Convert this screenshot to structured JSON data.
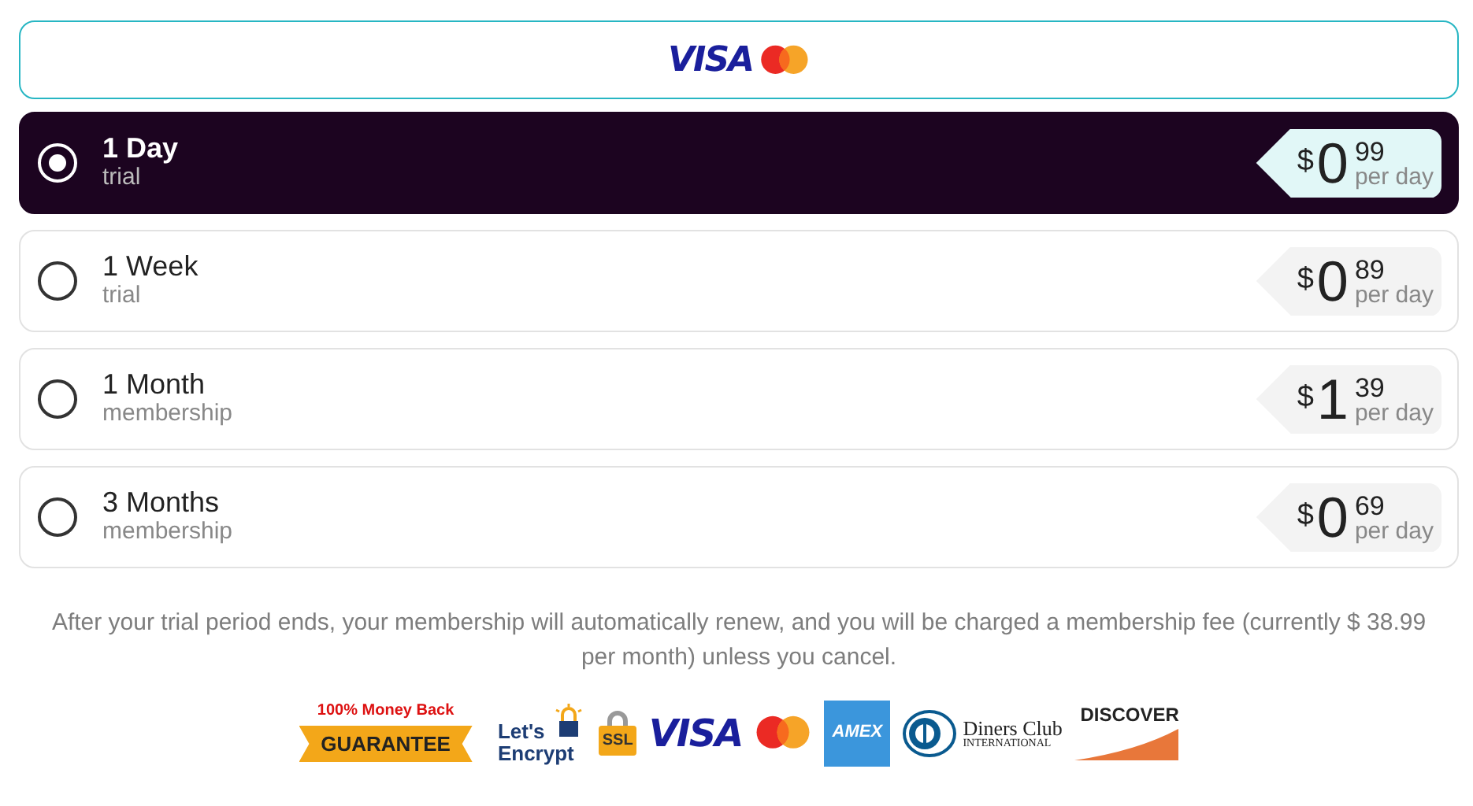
{
  "header_card": {
    "logos": [
      {
        "kind": "visa",
        "text": "VISA"
      },
      {
        "kind": "mastercard"
      }
    ]
  },
  "plans": [
    {
      "title": "1 Day",
      "subtitle": "trial",
      "selected": true,
      "currency": "$",
      "whole": "0",
      "cents": "99",
      "unit": "per day"
    },
    {
      "title": "1 Week",
      "subtitle": "trial",
      "selected": false,
      "currency": "$",
      "whole": "0",
      "cents": "89",
      "unit": "per day"
    },
    {
      "title": "1 Month",
      "subtitle": "membership",
      "selected": false,
      "currency": "$",
      "whole": "1",
      "cents": "39",
      "unit": "per day"
    },
    {
      "title": "3 Months",
      "subtitle": "membership",
      "selected": false,
      "currency": "$",
      "whole": "0",
      "cents": "69",
      "unit": "per day"
    }
  ],
  "notice": "After your trial period ends, your membership will automatically renew, and you will be charged a membership fee (currently $ 38.99 per month) unless you cancel.",
  "badges": [
    {
      "kind": "guarantee",
      "top": "100% Money Back",
      "text": "GUARANTEE"
    },
    {
      "kind": "letsencrypt",
      "lines": [
        "Let's",
        "Encrypt"
      ]
    },
    {
      "kind": "ssl",
      "text": "SSL"
    },
    {
      "kind": "visa",
      "text": "VISA"
    },
    {
      "kind": "mastercard"
    },
    {
      "kind": "amex",
      "text": "AMEX"
    },
    {
      "kind": "diners",
      "lines": [
        "Diners Club",
        "INTERNATIONAL"
      ]
    },
    {
      "kind": "discover",
      "text": "DISCOVER"
    }
  ]
}
